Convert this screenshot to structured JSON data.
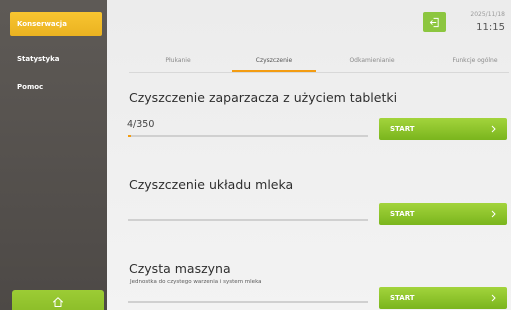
{
  "sidebar": {
    "items": [
      {
        "label": "Konserwacja",
        "active": true
      },
      {
        "label": "Statystyka",
        "active": false
      },
      {
        "label": "Pomoc",
        "active": false
      }
    ],
    "home_icon": "home-icon"
  },
  "header": {
    "logout_icon": "logout-icon",
    "date": "2025/11/18",
    "time": "11:15"
  },
  "tabs": [
    {
      "label": "Płukanie",
      "active": false
    },
    {
      "label": "Czyszczenie",
      "active": true
    },
    {
      "label": "Odkamienianie",
      "active": false
    },
    {
      "label": "Funkcje ogólne",
      "active": false
    }
  ],
  "cleaning": {
    "items": [
      {
        "title": "Czyszczenie zaparzacza z użyciem tabletki",
        "counter": "4/350",
        "progress": 0.011,
        "start_label": "START"
      },
      {
        "title": "Czyszczenie układu mleka",
        "progress": 0,
        "start_label": "START"
      },
      {
        "title": "Czysta maszyna",
        "subtitle": "Jednostka do czystego warzenia i system mleka",
        "start_label": "START"
      }
    ]
  },
  "colors": {
    "accent_green": "#8cc63f",
    "accent_yellow": "#f5bd2a",
    "accent_orange": "#f39c12",
    "sidebar": "#55514e"
  }
}
